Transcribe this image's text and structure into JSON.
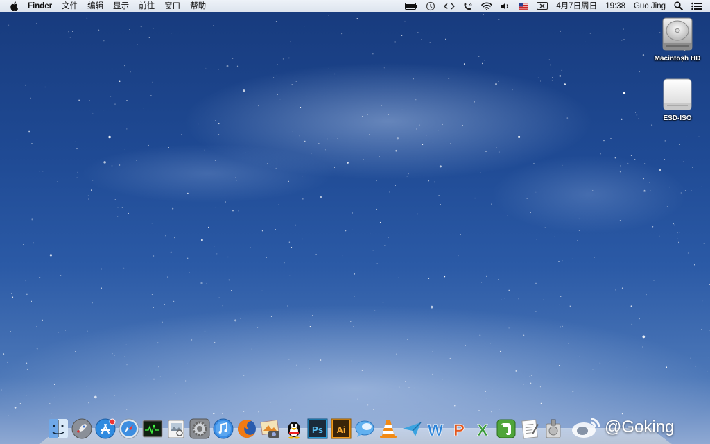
{
  "menubar": {
    "app_name": "Finder",
    "menus": [
      "文件",
      "编辑",
      "显示",
      "前往",
      "窗口",
      "帮助"
    ],
    "date": "4月7日周日",
    "time": "19:38",
    "user": "Guo Jing"
  },
  "desktop_icons": [
    {
      "label": "Macintosh HD",
      "icon": "hard-drive-icon"
    },
    {
      "label": "ESD-ISO",
      "icon": "external-drive-icon"
    }
  ],
  "dock": {
    "items": [
      {
        "name": "finder",
        "icon": "finder-icon"
      },
      {
        "name": "launchpad",
        "icon": "rocket-icon"
      },
      {
        "name": "app-store",
        "icon": "app-store-icon",
        "badge": true
      },
      {
        "name": "safari",
        "icon": "compass-icon"
      },
      {
        "name": "activity-monitor",
        "icon": "activity-monitor-icon"
      },
      {
        "name": "preview",
        "icon": "preview-icon"
      },
      {
        "name": "system-preferences",
        "icon": "gear-icon"
      },
      {
        "name": "itunes",
        "icon": "music-note-icon"
      },
      {
        "name": "firefox",
        "icon": "firefox-icon"
      },
      {
        "name": "iphoto",
        "icon": "photo-icon"
      },
      {
        "name": "qq",
        "icon": "penguin-icon"
      },
      {
        "name": "photoshop",
        "icon": "photoshop-icon",
        "text": "Ps"
      },
      {
        "name": "illustrator",
        "icon": "illustrator-icon",
        "text": "Ai"
      },
      {
        "name": "messages",
        "icon": "chat-bubble-icon"
      },
      {
        "name": "vlc",
        "icon": "traffic-cone-icon"
      },
      {
        "name": "airplane-app",
        "icon": "airplane-icon"
      },
      {
        "name": "word",
        "icon": "word-icon",
        "text": "W"
      },
      {
        "name": "powerpoint",
        "icon": "powerpoint-icon",
        "text": "P"
      },
      {
        "name": "excel",
        "icon": "excel-icon",
        "text": "X"
      },
      {
        "name": "evernote",
        "icon": "elephant-icon"
      },
      {
        "name": "textedit",
        "icon": "document-icon"
      },
      {
        "name": "disk-utility",
        "icon": "disk-utility-icon"
      }
    ]
  },
  "watermark": "@Goking",
  "colors": {
    "menubar_bg": "#e4eaf3",
    "ps_blue": "#2a9bd6",
    "ai_orange": "#f19a1b",
    "word_blue": "#2a83d9",
    "ppt_orange": "#e2571e",
    "excel_green": "#3a9a3c",
    "evernote_green": "#4fa53a"
  }
}
